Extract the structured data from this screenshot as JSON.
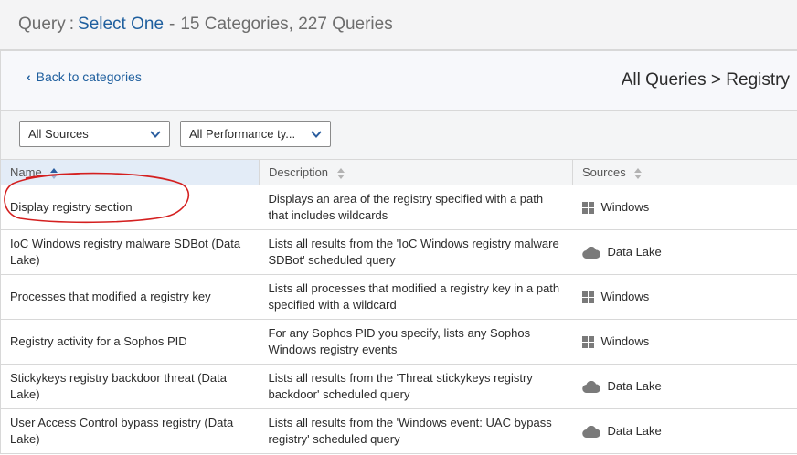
{
  "header": {
    "label": "Query",
    "separator": ":",
    "select_link": "Select One",
    "dash": "-",
    "summary": "15 Categories, 227 Queries"
  },
  "nav": {
    "back_label": "Back to categories",
    "breadcrumb": "All Queries > Registry"
  },
  "filters": {
    "sources_value": "All Sources",
    "performance_value": "All Performance ty..."
  },
  "table": {
    "columns": [
      "Name",
      "Description",
      "Sources"
    ],
    "rows": [
      {
        "name": "Display registry section",
        "description": "Displays an area of the registry specified with a path that includes wildcards",
        "source": "Windows",
        "source_icon": "windows-icon"
      },
      {
        "name": "IoC Windows registry malware SDBot (Data Lake)",
        "description": "Lists all results from the 'IoC Windows registry malware SDBot' scheduled query",
        "source": "Data Lake",
        "source_icon": "cloud-icon"
      },
      {
        "name": "Processes that modified a registry key",
        "description": "Lists all processes that modified a registry key in a path specified with a wildcard",
        "source": "Windows",
        "source_icon": "windows-icon"
      },
      {
        "name": "Registry activity for a Sophos PID",
        "description": "For any Sophos PID you specify, lists any Sophos Windows registry events",
        "source": "Windows",
        "source_icon": "windows-icon"
      },
      {
        "name": "Stickykeys registry backdoor threat (Data Lake)",
        "description": "Lists all results from the 'Threat stickykeys registry backdoor' scheduled query",
        "source": "Data Lake",
        "source_icon": "cloud-icon"
      },
      {
        "name": "User Access Control bypass registry (Data Lake)",
        "description": "Lists all results from the 'Windows event: UAC bypass registry' scheduled query",
        "source": "Data Lake",
        "source_icon": "cloud-icon"
      }
    ]
  },
  "colors": {
    "link": "#1f5f9e",
    "annotation": "#d42020",
    "icon_gray": "#7a7a7a"
  }
}
